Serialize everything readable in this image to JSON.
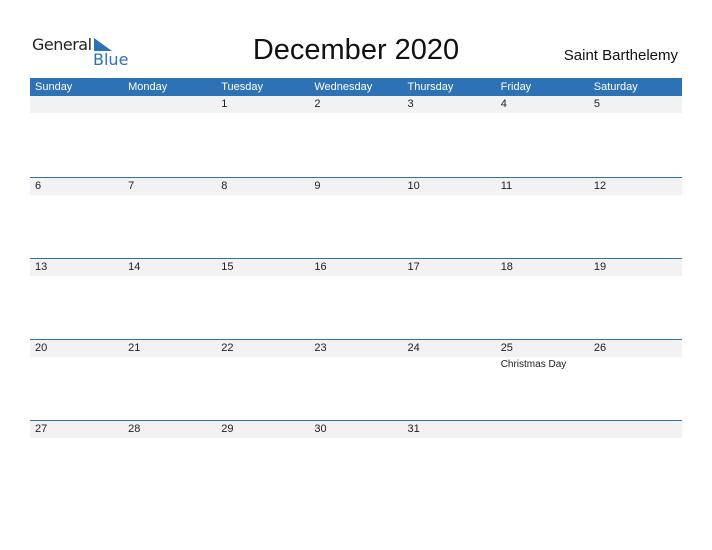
{
  "logo": {
    "general": "General",
    "blue": "Blue"
  },
  "title": "December 2020",
  "country": "Saint Barthelemy",
  "colors": {
    "accent": "#2e72b6",
    "band": "#f2f2f2"
  },
  "weekdays": [
    "Sunday",
    "Monday",
    "Tuesday",
    "Wednesday",
    "Thursday",
    "Friday",
    "Saturday"
  ],
  "weeks": [
    [
      {
        "d": ""
      },
      {
        "d": ""
      },
      {
        "d": "1"
      },
      {
        "d": "2"
      },
      {
        "d": "3"
      },
      {
        "d": "4"
      },
      {
        "d": "5"
      }
    ],
    [
      {
        "d": "6"
      },
      {
        "d": "7"
      },
      {
        "d": "8"
      },
      {
        "d": "9"
      },
      {
        "d": "10"
      },
      {
        "d": "11"
      },
      {
        "d": "12"
      }
    ],
    [
      {
        "d": "13"
      },
      {
        "d": "14"
      },
      {
        "d": "15"
      },
      {
        "d": "16"
      },
      {
        "d": "17"
      },
      {
        "d": "18"
      },
      {
        "d": "19"
      }
    ],
    [
      {
        "d": "20"
      },
      {
        "d": "21"
      },
      {
        "d": "22"
      },
      {
        "d": "23"
      },
      {
        "d": "24"
      },
      {
        "d": "25",
        "event": "Christmas Day"
      },
      {
        "d": "26"
      }
    ],
    [
      {
        "d": "27"
      },
      {
        "d": "28"
      },
      {
        "d": "29"
      },
      {
        "d": "30"
      },
      {
        "d": "31"
      },
      {
        "d": ""
      },
      {
        "d": ""
      }
    ]
  ]
}
